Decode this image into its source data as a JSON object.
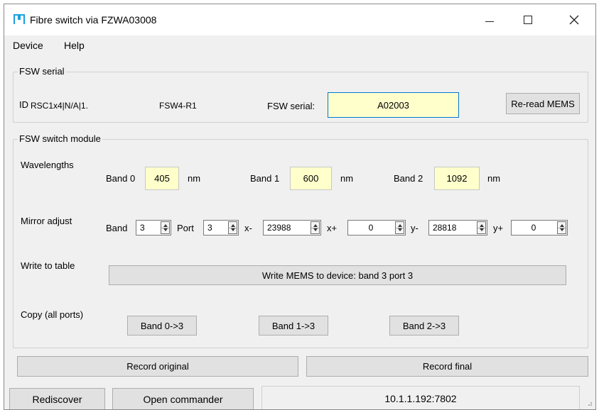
{
  "window": {
    "title": "Fibre switch via FZWA03008",
    "controls": {
      "minimize": "—",
      "maximize": "☐",
      "close": "✕"
    }
  },
  "menu": {
    "items": [
      "Device",
      "Help"
    ]
  },
  "fsw_serial": {
    "group_title": "FSW serial",
    "id_label": "ID",
    "id_value": "RSC1x4|N/A|1.",
    "model": "FSW4-R1",
    "serial_label": "FSW serial:",
    "serial_value": "A02003",
    "reread_label": "Re-read MEMS"
  },
  "module": {
    "group_title": "FSW switch module",
    "wavelengths_label": "Wavelengths",
    "bands": [
      {
        "label": "Band 0",
        "value": "405",
        "unit": "nm"
      },
      {
        "label": "Band 1",
        "value": "600",
        "unit": "nm"
      },
      {
        "label": "Band 2",
        "value": "1092",
        "unit": "nm"
      }
    ],
    "mirror_label": "Mirror adjust",
    "mirror": {
      "band_label": "Band",
      "band_value": "3",
      "port_label": "Port",
      "port_value": "3",
      "xminus_label": "x-",
      "xminus_value": "23988",
      "xplus_label": "x+",
      "xplus_value": "0",
      "yminus_label": "y-",
      "yminus_value": "28818",
      "yplus_label": "y+",
      "yplus_value": "0"
    },
    "write_label": "Write to table",
    "write_button": "Write MEMS to device:  band 3 port 3",
    "copy_label": "Copy (all ports)",
    "copy_buttons": [
      "Band 0->3",
      "Band 1->3",
      "Band 2->3"
    ]
  },
  "record": {
    "original": "Record original",
    "final": "Record final"
  },
  "status": {
    "rediscover": "Rediscover",
    "open_commander": "Open commander",
    "address": "10.1.1.192:7802"
  },
  "colors": {
    "field_highlight": "#ffffcc",
    "focus": "#0078d7",
    "icon": "#1a9fe0"
  }
}
